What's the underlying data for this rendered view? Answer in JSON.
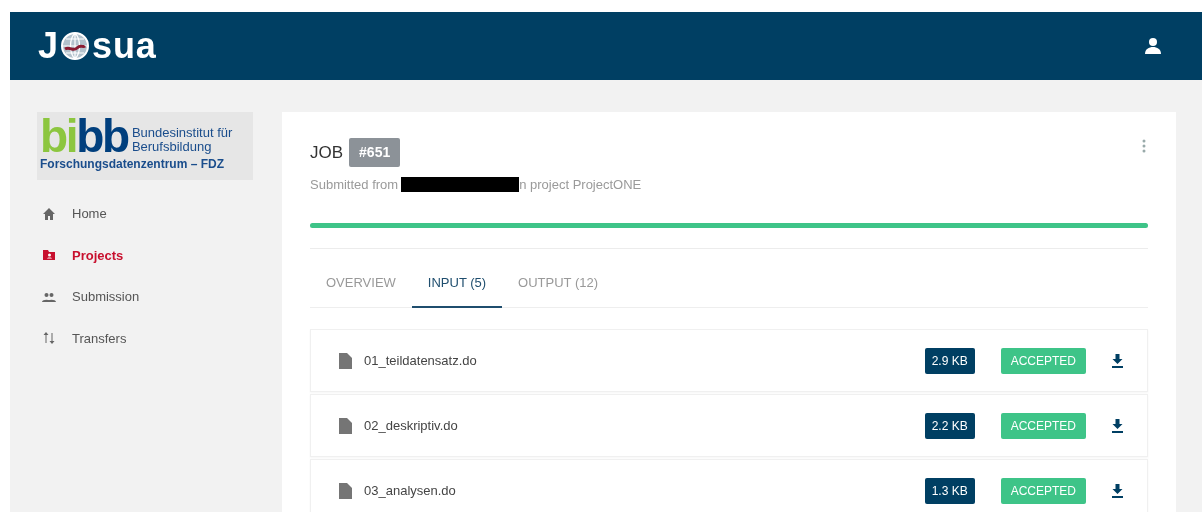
{
  "header": {
    "logo": {
      "left": "J",
      "right": "sua"
    }
  },
  "sidebar": {
    "org_logo": {
      "mark_green": "bi",
      "mark_blue": "bb",
      "line_1": "Bundesinstitut für",
      "line_2": "Berufsbildung",
      "line_3": "Forschungsdatenzentrum – FDZ"
    },
    "items": [
      {
        "label": "Home",
        "selected": false
      },
      {
        "label": "Projects",
        "selected": true
      },
      {
        "label": "Submission",
        "selected": false
      },
      {
        "label": "Transfers",
        "selected": false
      }
    ]
  },
  "job": {
    "label": "JOB",
    "number": "#651",
    "submitted_prefix": "Submitted from",
    "submitted_suffix": "n project ProjectONE",
    "progress": {
      "level": 1
    },
    "tabs": [
      {
        "label": "OVERVIEW",
        "selected": false
      },
      {
        "label": "INPUT (5)",
        "selected": true
      },
      {
        "label": "OUTPUT (12)",
        "selected": false
      }
    ],
    "files": [
      {
        "name": "01_teildatensatz.do",
        "size": "2.9 KB",
        "status": "ACCEPTED",
        "color": "#3ec488"
      },
      {
        "name": "02_deskriptiv.do",
        "size": "2.2 KB",
        "status": "ACCEPTED",
        "color": "#3ec488"
      },
      {
        "name": "03_analysen.do",
        "size": "1.3 KB",
        "status": "ACCEPTED",
        "color": "#3ec488"
      }
    ]
  }
}
